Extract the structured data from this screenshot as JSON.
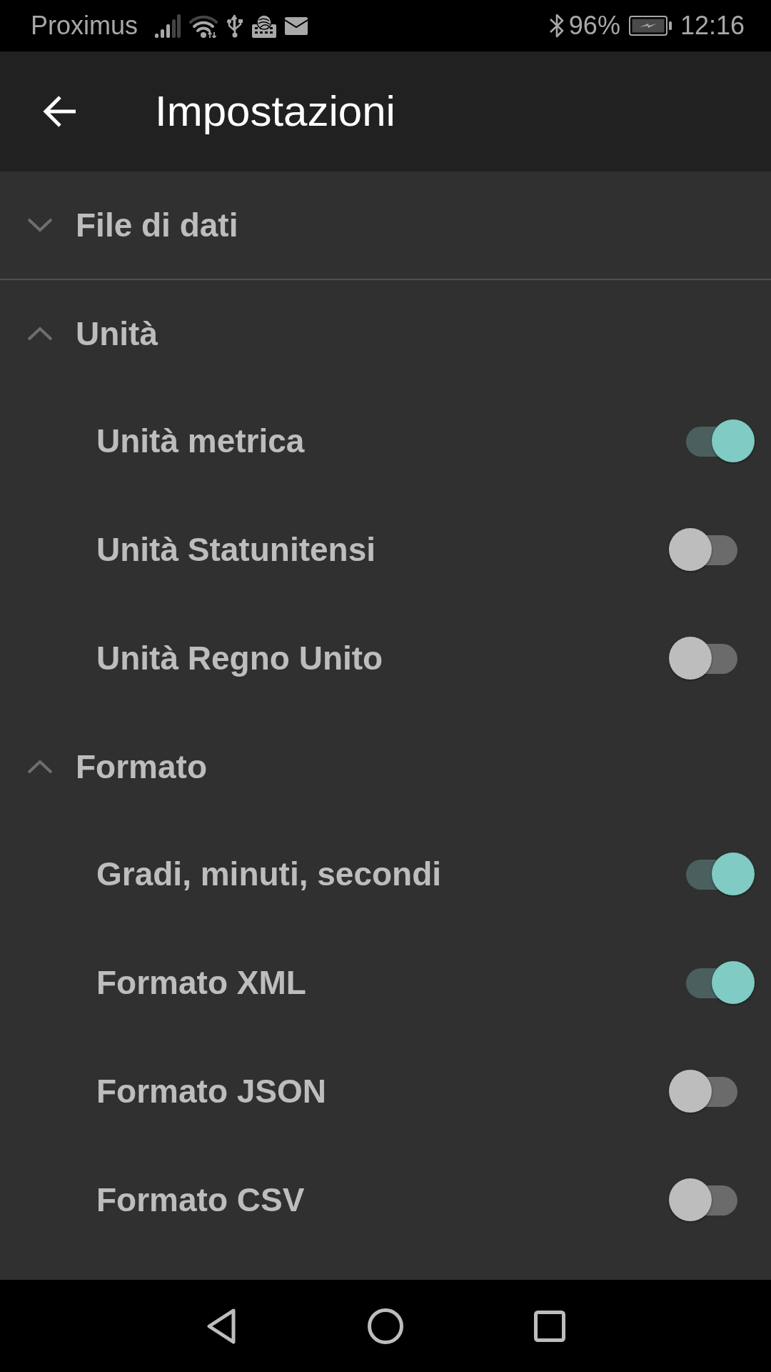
{
  "status_bar": {
    "carrier": "Proximus",
    "battery": "96%",
    "time": "12:16"
  },
  "app_bar": {
    "title": "Impostazioni"
  },
  "sections": [
    {
      "title": "File di dati",
      "expanded": false
    },
    {
      "title": "Unità",
      "expanded": true,
      "items": [
        {
          "label": "Unità metrica",
          "on": true
        },
        {
          "label": "Unità Statunitensi",
          "on": false
        },
        {
          "label": "Unità Regno Unito",
          "on": false
        }
      ]
    },
    {
      "title": "Formato",
      "expanded": true,
      "items": [
        {
          "label": "Gradi, minuti, secondi",
          "on": true
        },
        {
          "label": "Formato XML",
          "on": true
        },
        {
          "label": "Formato JSON",
          "on": false
        },
        {
          "label": "Formato CSV",
          "on": false
        }
      ]
    }
  ]
}
